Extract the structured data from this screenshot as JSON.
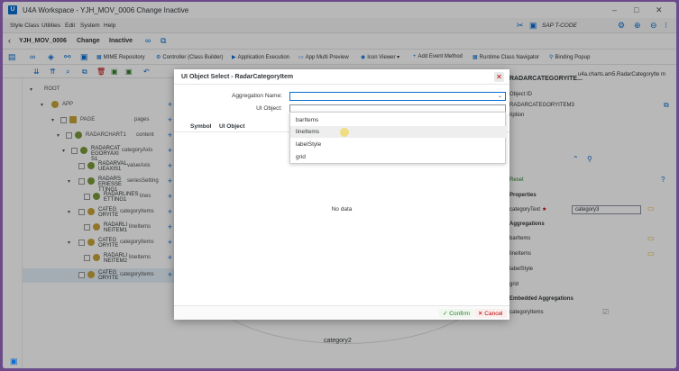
{
  "window": {
    "title": "U4A Workspace - YJH_MOV_0006 Change Inactive"
  },
  "menu": {
    "items": [
      "Style Class",
      "Utilities",
      "Edit",
      "System",
      "Help"
    ],
    "tcode_label": "SAP T-CODE"
  },
  "header": {
    "app_id": "YJH_MOV_0006",
    "mode": "Change",
    "status": "Inactive"
  },
  "toolbar": {
    "mime": "MIME Repository",
    "controller": "Controller (Class Builder)",
    "app_exec": "Application Execution",
    "multi_preview": "App Multi Preview",
    "icon_viewer": "Icon Viewer",
    "add_event": "Add Event Method",
    "runtime_nav": "Runtime Class Navigator",
    "binding_popup": "Binding Popup"
  },
  "tree": {
    "root": "ROOT",
    "rows": [
      {
        "name": "APP",
        "agg": ""
      },
      {
        "name": "PAGE",
        "agg": "pages"
      },
      {
        "name": "RADARCHART1",
        "agg": "content"
      },
      {
        "name": "RADARCAT EGORYAXI S1",
        "agg": "categoryAxis"
      },
      {
        "name": "RADARVAL UEAXIS1",
        "agg": "valueAxis"
      },
      {
        "name": "RADARS ERIESSE TTING1",
        "agg": "seriesSetting"
      },
      {
        "name": "RADARLINES ETTING1",
        "agg": "lines"
      },
      {
        "name": "CATEG ORYITE",
        "agg": "categoryItems"
      },
      {
        "name": "RADARLI NEITEM1",
        "agg": "lineItems"
      },
      {
        "name": "CATEG ORYITE",
        "agg": "categoryItems"
      },
      {
        "name": "RADARLI NEITEM2",
        "agg": "lineItems"
      },
      {
        "name": "CATEG ORYITE",
        "agg": "categoryItems"
      }
    ]
  },
  "dialog": {
    "title": "UI Object Select - RadarCategoryItem",
    "agg_label": "Aggregation Name:",
    "obj_label": "UI Object:",
    "col_symbol": "Symbol",
    "col_object": "UI Object",
    "no_data": "No data",
    "confirm": "Confirm",
    "cancel": "Cancel",
    "options": [
      "barItems",
      "lineItems",
      "labelStyle",
      "grid"
    ]
  },
  "right": {
    "header": "RADARCATEGORYITE...",
    "class_name": "u4a.charts.am5.RadarCategoryIte m",
    "object_id_label": "Object ID",
    "object_id_value": "RADARCATEGORYITEM3",
    "description_label": "ription",
    "reset": "Reset",
    "properties": "Properties",
    "category_text_label": "categoryText",
    "category_text_value": "category3",
    "aggregations": "Aggregations",
    "agg1": "barItems",
    "agg2": "lineItems",
    "agg3": "labelStyle",
    "agg4": "grid",
    "embedded": "Embedded Aggregations",
    "embedded1": "categoryItems"
  },
  "chart_label": "category2"
}
